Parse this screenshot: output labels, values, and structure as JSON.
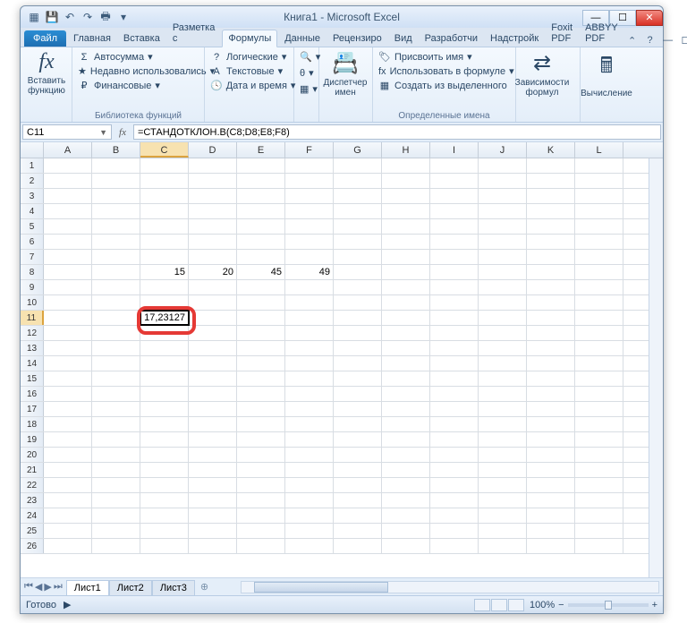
{
  "title": "Книга1 - Microsoft Excel",
  "qat": {
    "save": "💾",
    "undo": "↶",
    "redo": "↷",
    "print": "🖶"
  },
  "file_tab": "Файл",
  "tabs": [
    "Главная",
    "Вставка",
    "Разметка с",
    "Формулы",
    "Данные",
    "Рецензиро",
    "Вид",
    "Разработчи",
    "Надстройк",
    "Foxit PDF",
    "ABBYY PDF"
  ],
  "active_tab": 3,
  "ribbon": {
    "insert_fn": {
      "label": "Вставить\nфункцию",
      "icon": "fx"
    },
    "autosum": "Автосумма",
    "recent": "Недавно использовались",
    "financial": "Финансовые",
    "lib_label": "Библиотека функций",
    "logical": "Логические",
    "text": "Текстовые",
    "datetime": "Дата и время",
    "name_mgr": "Диспетчер\nимен",
    "assign_name": "Присвоить имя",
    "use_in_formula": "Использовать в формуле",
    "create_from_sel": "Создать из выделенного",
    "defined_label": "Определенные имена",
    "deps": "Зависимости\nформул",
    "calc": "Вычисление"
  },
  "namebox": "C11",
  "formula": "=СТАНДОТКЛОН.В(C8;D8;E8;F8)",
  "fx_symbol": "fx",
  "columns": [
    "A",
    "B",
    "C",
    "D",
    "E",
    "F",
    "G",
    "H",
    "I",
    "J",
    "K",
    "L"
  ],
  "sel_col_idx": 2,
  "row_count": 26,
  "sel_row": 11,
  "cells": {
    "r8": {
      "C": "15",
      "D": "20",
      "E": "45",
      "F": "49"
    },
    "r11": {
      "C": "17,23127"
    }
  },
  "sheets": [
    "Лист1",
    "Лист2",
    "Лист3"
  ],
  "active_sheet": 0,
  "status": "Готово",
  "zoom": "100%"
}
